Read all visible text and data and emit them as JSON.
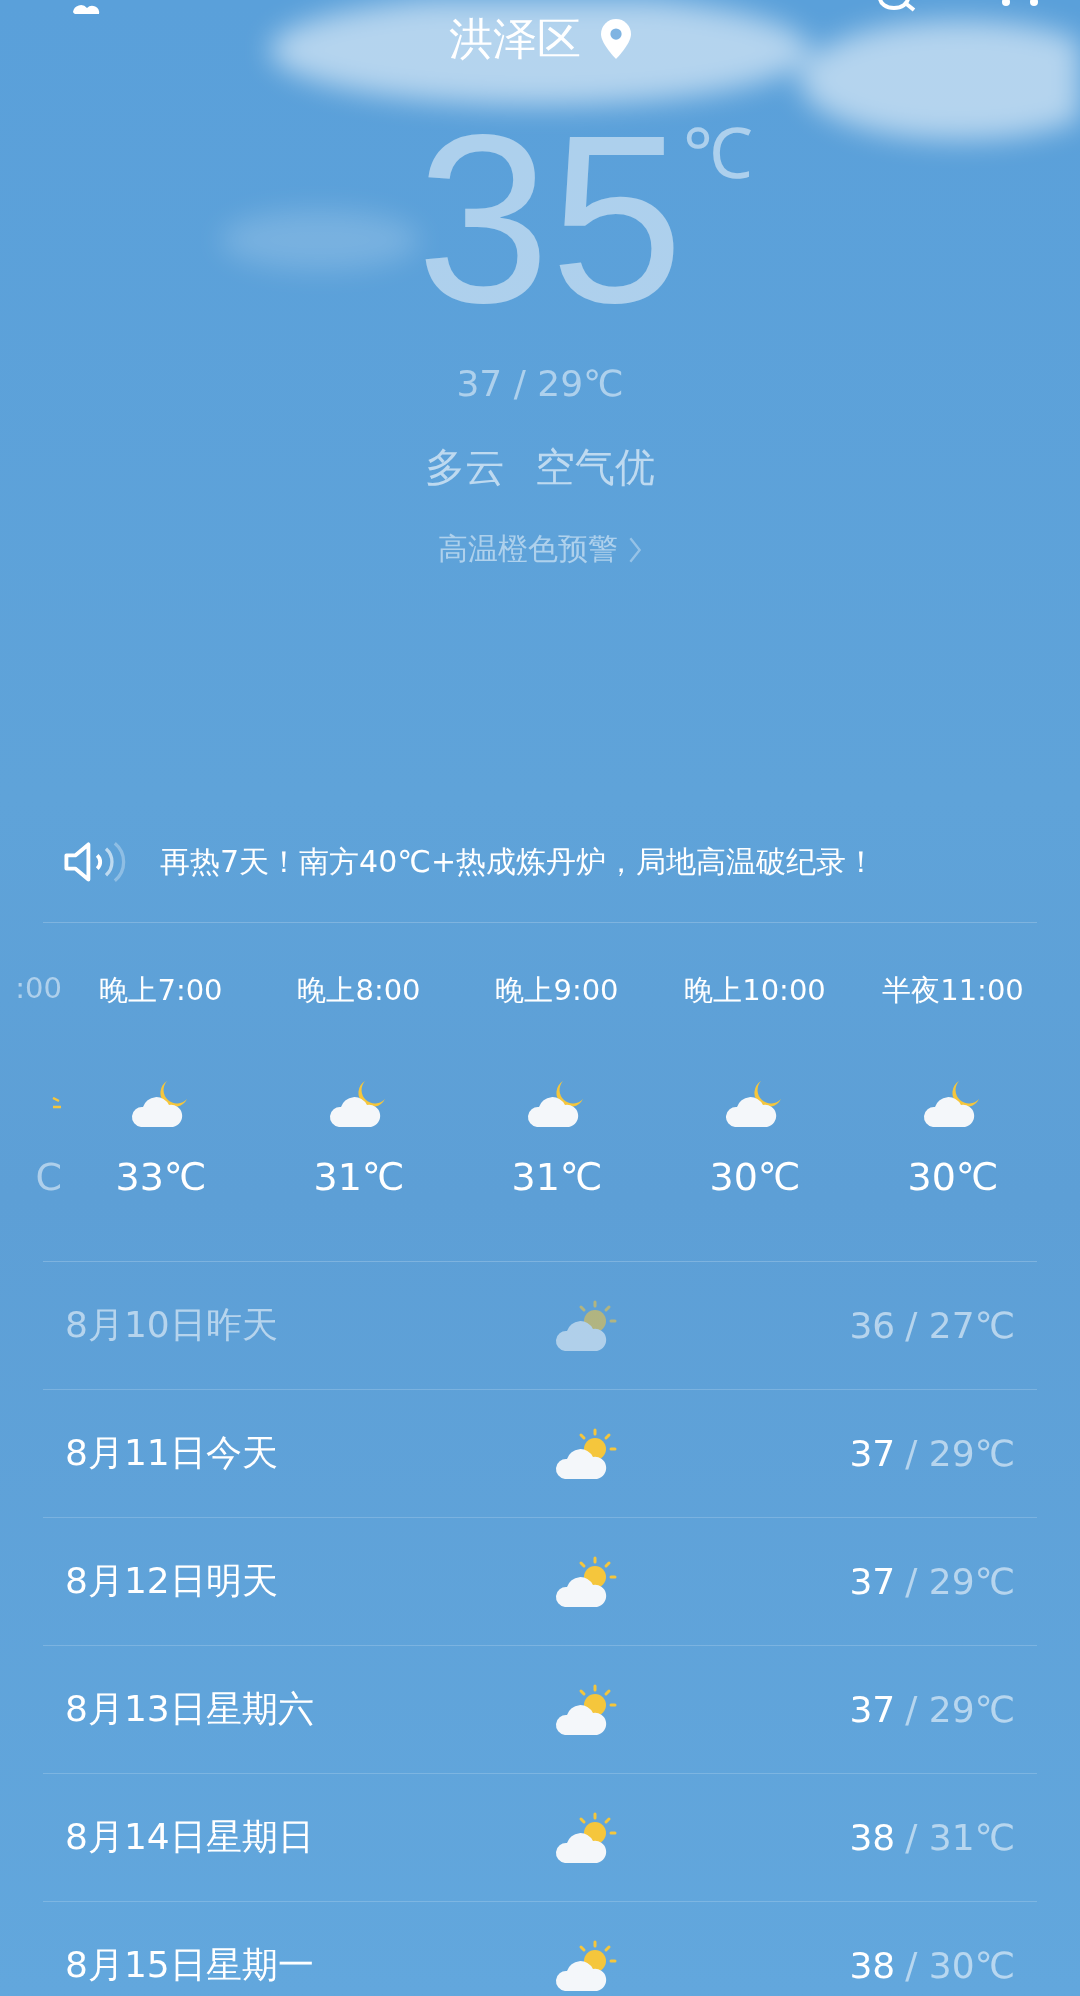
{
  "header": {
    "city": "洪泽区"
  },
  "current": {
    "temp": "35",
    "unit": "℃",
    "range": "37 / 29℃",
    "condition": "多云",
    "air": "空气优",
    "warning": "高温橙色预警"
  },
  "news": {
    "text": "再热7天！南方40℃+热成炼丹炉，局地高温破纪录！"
  },
  "hourly": [
    {
      "time": ":00",
      "temp": "C",
      "kind": "sun",
      "partial": true
    },
    {
      "time": "晚上7:00",
      "temp": "33℃",
      "kind": "moon",
      "partial": false
    },
    {
      "time": "晚上8:00",
      "temp": "31℃",
      "kind": "moon",
      "partial": false
    },
    {
      "time": "晚上9:00",
      "temp": "31℃",
      "kind": "moon",
      "partial": false
    },
    {
      "time": "晚上10:00",
      "temp": "30℃",
      "kind": "moon",
      "partial": false
    },
    {
      "time": "半夜11:00",
      "temp": "30℃",
      "kind": "moon",
      "partial": false
    }
  ],
  "daily": [
    {
      "date": "8月10日昨天",
      "high": "36",
      "low": "/ 27℃",
      "past": true
    },
    {
      "date": "8月11日今天",
      "high": "37",
      "low": "/ 29℃",
      "past": false
    },
    {
      "date": "8月12日明天",
      "high": "37",
      "low": "/ 29℃",
      "past": false
    },
    {
      "date": "8月13日星期六",
      "high": "37",
      "low": "/ 29℃",
      "past": false
    },
    {
      "date": "8月14日星期日",
      "high": "38",
      "low": "/ 31℃",
      "past": false
    },
    {
      "date": "8月15日星期一",
      "high": "38",
      "low": "/ 30℃",
      "past": false
    }
  ]
}
